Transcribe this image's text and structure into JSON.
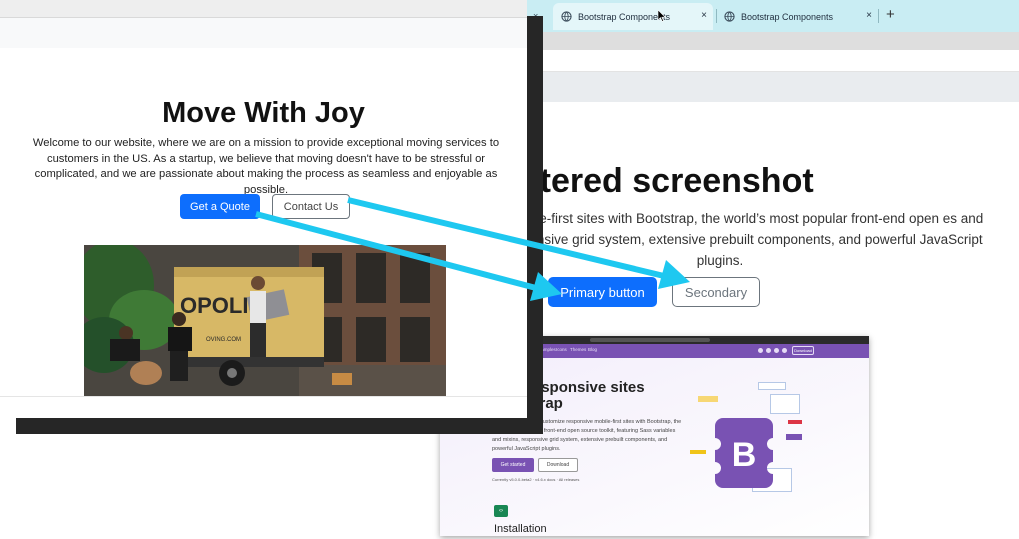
{
  "browser": {
    "tabs": [
      {
        "label": "Bootstrap Components",
        "active": true
      },
      {
        "label": "Bootstrap Components",
        "active": false
      }
    ],
    "new_tab_symbol": "+",
    "close_symbol": "×"
  },
  "background_page": {
    "heading": "entered screenshot",
    "lead": "ponsive mobile-first sites with Bootstrap, the world’s most popular front-end open es and mixins, responsive grid system, extensive prebuilt components, and powerful JavaScript plugins.",
    "primary_button": "Primary button",
    "secondary_button": "Secondary",
    "preview": {
      "nav_items": [
        "Examples",
        "Icons",
        "Themes",
        "Blog"
      ],
      "nav_download": "Download",
      "heading": "fast, responsive sites Bootstrap",
      "paragraph": "Quickly design and customize responsive mobile-first sites with Bootstrap, the world’s most popular front-end open source toolkit, featuring Sass variables and mixins, responsive grid system, extensive prebuilt components, and powerful JavaScript plugins.",
      "get_started": "Get started",
      "download": "Download",
      "currently": "Currently v5.0.0-beta2 · v4.6.x docs · All releases",
      "logo_letter": "B",
      "installation": "Installation"
    }
  },
  "foreground_window": {
    "title": "Move With Joy",
    "lead": "Welcome to our website, where we are on a mission to provide exceptional moving services to customers in the US. As a startup, we believe that moving doesn't have to be stressful or complicated, and we are passionate about making the process as seamless and enjoyable as possible.",
    "primary_button": "Get a Quote",
    "secondary_button": "Contact Us",
    "photo_truck_text": "OPOLIS",
    "photo_small_text": "OVING.COM"
  },
  "colors": {
    "primary": "#0d6efd",
    "secondary": "#6c757d",
    "annotation_arrow": "#1ec8f0",
    "bootstrap_purple": "#7952b3",
    "tab_bar": "#c9edf3"
  }
}
